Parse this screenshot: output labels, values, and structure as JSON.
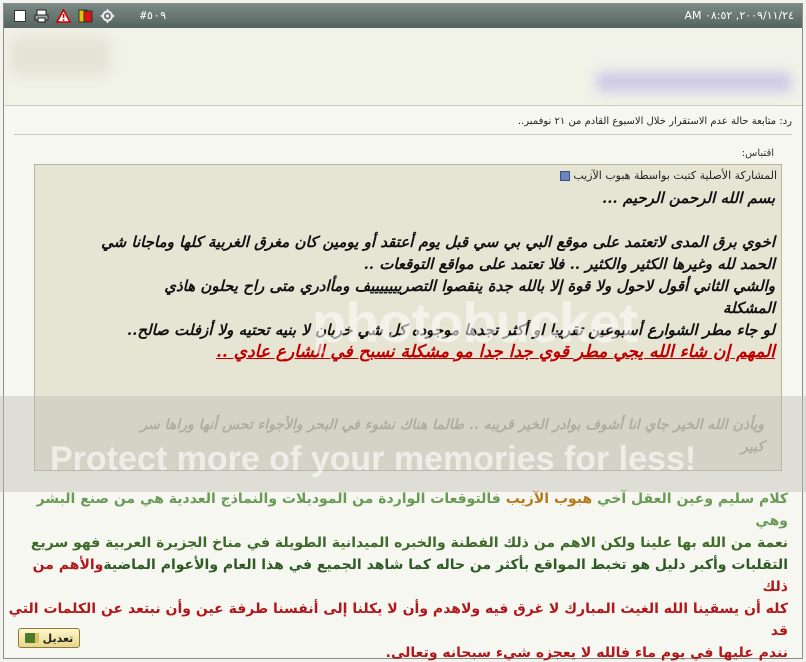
{
  "header": {
    "post_number": "#٥٠٩",
    "date": "٢٠٠٩/١١/٢٤, ٠٨:٥٢ AM"
  },
  "reply_title": "رد: متابعة حالة عدم الاستقرار خلال الاسبوع القادم من ٢١ نوفمبر..",
  "quote": {
    "caption": "اقتباس:",
    "origin": "المشاركة الأصلية كتبت بواسطة هبوب الآزيب",
    "lines": [
      "بسم الله الرحمن الرحيم ...",
      "اخوي برق المدى لاتعتمد على موقع البي بي سي قبل يوم أعتقد أو يومين كان مغرق الغربية كلها وماجانا شي",
      "الحمد لله وغيرها الكثير والكثير .. فلا تعتمد على مواقع التوقعات ..",
      "والشي الثاني أقول لاحول ولا قوة إلا بالله جدة ينقصوا التصريييييييف ومأادري متى راح يحلون هاذي",
      "المشكلة",
      "لو جاء مطر الشوارع أسبوعين تقريبا او أكثر تجدها موجوده كل شي خربان لا بنيه تحتيه ولا أزفلت صالح..",
      "المهم إن شاء الله يجي مطر قوي جدا جدا مو مشكلة نسبح في الشارع عادي ..",
      "ويأذن الله الخير جاي انا أشوف بوادر الخير قريبه .. طالما هناك نشوء في البحر والأجواء تحس أنها وراها سر",
      "كبير"
    ]
  },
  "reply": {
    "line1_a": "كلام سليم وعين العقل آخي",
    "line1_name": "هبوب الآزيب",
    "line1_b": "فالتوقعات الواردة من الموديلات والنماذج العددية هي من صنع البشر وهي",
    "line2": "نعمة من الله بها علينا ولكن الاهم من ذلك الفطنة والخبره الميدانية الطويلة في مناخ الجزيرة العربية فهو سريع",
    "line3_a": "التقلبات وأكبر دليل هو تخبط المواقع بأكثر من حاله كما شاهد الجميع في هذا العام والأعوام الماضية",
    "line3_b": "والأهم من ذلك",
    "line4": "كله أن يسقينا الله الغيث المبارك لا غرق فيه ولاهدم وأن لا يكلنا إلى أنفسنا طرفة عين وأن نبتعد عن الكلمات التي قد",
    "line5": "نندم عليها في يوم ماء فالله لا يعجزه شيء سبحانه وتعالى."
  },
  "watermark": {
    "logo": "photobucket",
    "text": "Protect more of your memories for less!"
  },
  "edit_button": {
    "label": "تعديل"
  }
}
